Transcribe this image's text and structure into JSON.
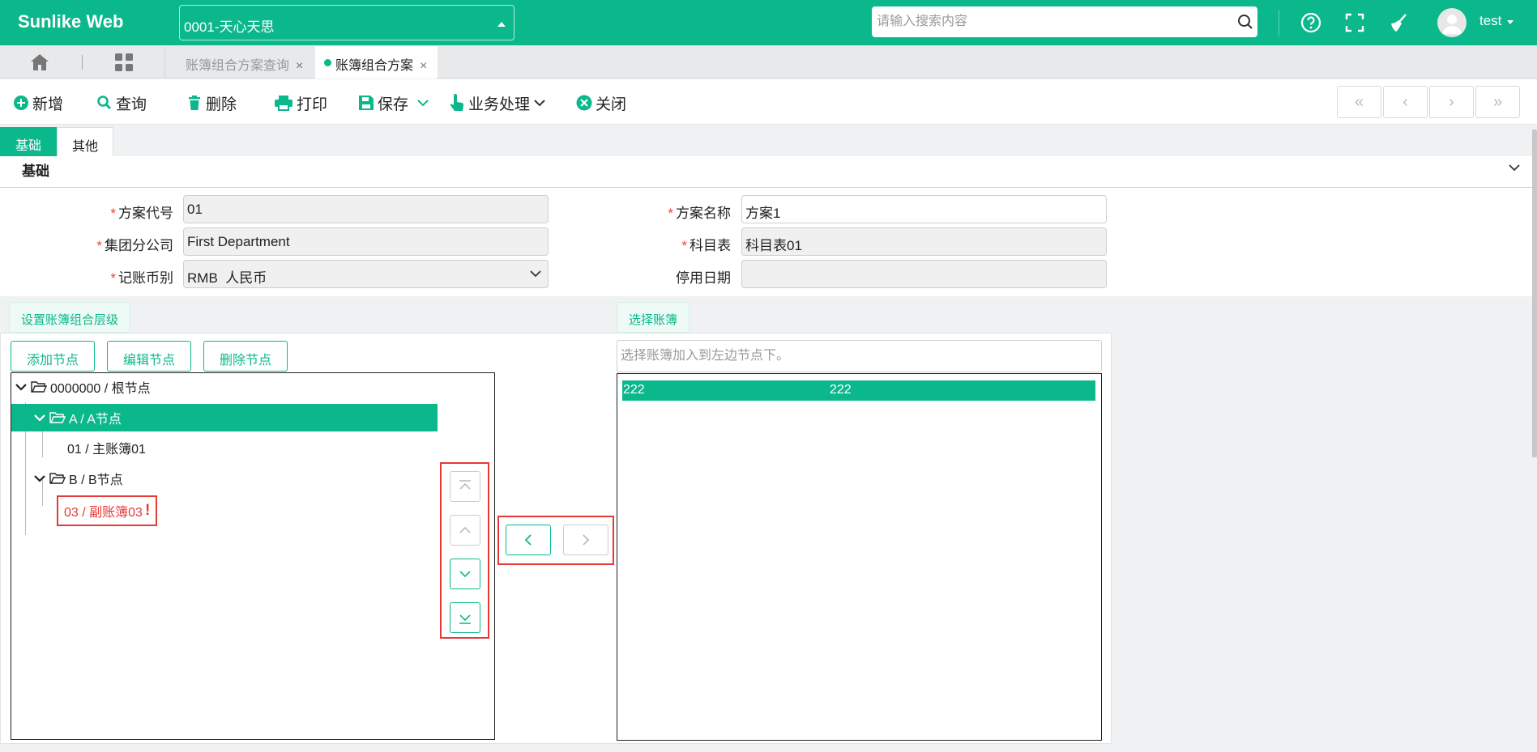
{
  "app": {
    "brand": "Sunlike Web",
    "company": "0001-天心天思",
    "search_placeholder": "请输入搜索内容",
    "user": "test"
  },
  "tabs": [
    {
      "label": "账簿组合方案查询",
      "close": "×"
    },
    {
      "label": "账簿组合方案",
      "close": "×"
    }
  ],
  "toolbar": {
    "new": "新增",
    "query": "查询",
    "delete": "删除",
    "print": "打印",
    "save": "保存",
    "business": "业务处理",
    "close": "关闭"
  },
  "nav": {
    "first": "«",
    "prev": "‹",
    "next": "›",
    "last": "»"
  },
  "section_tabs": {
    "basic": "基础",
    "other": "其他"
  },
  "section": {
    "title": "基础"
  },
  "form": {
    "required_mark": "*",
    "plan_code_label": "方案代号",
    "plan_code": "01",
    "plan_name_label": "方案名称",
    "plan_name": "方案1",
    "branch_label": "集团分公司",
    "branch": "First Department",
    "chart_label": "科目表",
    "chart": "科目表01",
    "currency_label": "记账币别",
    "currency": "RMB  人民币",
    "disable_date_label": "停用日期",
    "disable_date": ""
  },
  "hierarchy": {
    "tab": "设置账簿组合层级",
    "add": "添加节点",
    "edit": "编辑节点",
    "remove": "删除节点",
    "nodes": {
      "root": "0000000 / 根节点",
      "a": "A / A节点",
      "a1": "01 / 主账簿01",
      "b": "B / B节点",
      "b1": "03 / 副账簿03",
      "b1_flag": "!"
    }
  },
  "books": {
    "tab": "选择账簿",
    "placeholder": "选择账簿加入到左边节点下。",
    "rows": [
      {
        "code": "222",
        "name": "222"
      }
    ]
  }
}
